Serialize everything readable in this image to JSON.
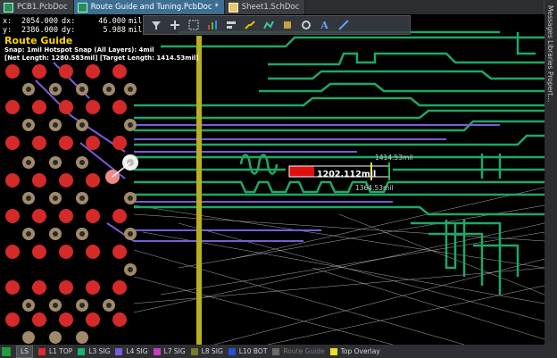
{
  "tabs": [
    {
      "label": "PCB1.PcbDoc",
      "active": false,
      "modified": false
    },
    {
      "label": "Route Guide and Tuning.PcbDoc",
      "active": true,
      "modified": true
    },
    {
      "label": "Sheet1.SchDoc",
      "active": false,
      "modified": false
    }
  ],
  "modified_marker": "*",
  "right_panel": "Messages Libraries Propert...",
  "hud": {
    "x_label": "x:",
    "x_value": "2054.000",
    "dx_label": "dx:",
    "dx_value": "46.000",
    "dx_unit": "mil",
    "y_label": "y:",
    "y_value": "2386.000",
    "dy_label": "dy:",
    "dy_value": "5.988",
    "dy_unit": "mil"
  },
  "route_guide": {
    "title": "Route Guide",
    "snap": "Snap: 1mil Hotspot Snap (All Layers): 4mil",
    "lengths": "[Net Length: 1280.583mil] [Target Length: 1414.53mil]"
  },
  "annotations": {
    "target": "1414.53mil",
    "current": "1202.112mil",
    "min": "1364.53mil"
  },
  "toolbar_icons": [
    "filter-icon",
    "add-icon",
    "select-rect-icon",
    "chart-icon",
    "align-icon",
    "route-icon",
    "interactive-route-icon",
    "pad-icon",
    "via-icon",
    "text-icon",
    "line-icon"
  ],
  "layer_tabs": [
    {
      "label": "LS",
      "color": "#1f9e3a",
      "is_button": true
    },
    {
      "label": "L1 TOP",
      "color": "#e0282e"
    },
    {
      "label": "L3 SIG",
      "color": "#18b36a"
    },
    {
      "label": "L4 SIG",
      "color": "#7b5cd6"
    },
    {
      "label": "L7 SIG",
      "color": "#c83cc0"
    },
    {
      "label": "L8 SIG",
      "color": "#7a7a28"
    },
    {
      "label": "L10 BOT",
      "color": "#2b4fd6"
    },
    {
      "label": "Route Guide",
      "color": "#6a6a6a",
      "dim": true
    },
    {
      "label": "Top Overlay",
      "color": "#f0e020"
    }
  ],
  "colors": {
    "green_trace": "#1fa865",
    "purple_trace": "#7b5cd6",
    "yellow_bar": "#b8b020",
    "pad": "#a08a6a",
    "red_pad": "#d42a2a"
  }
}
